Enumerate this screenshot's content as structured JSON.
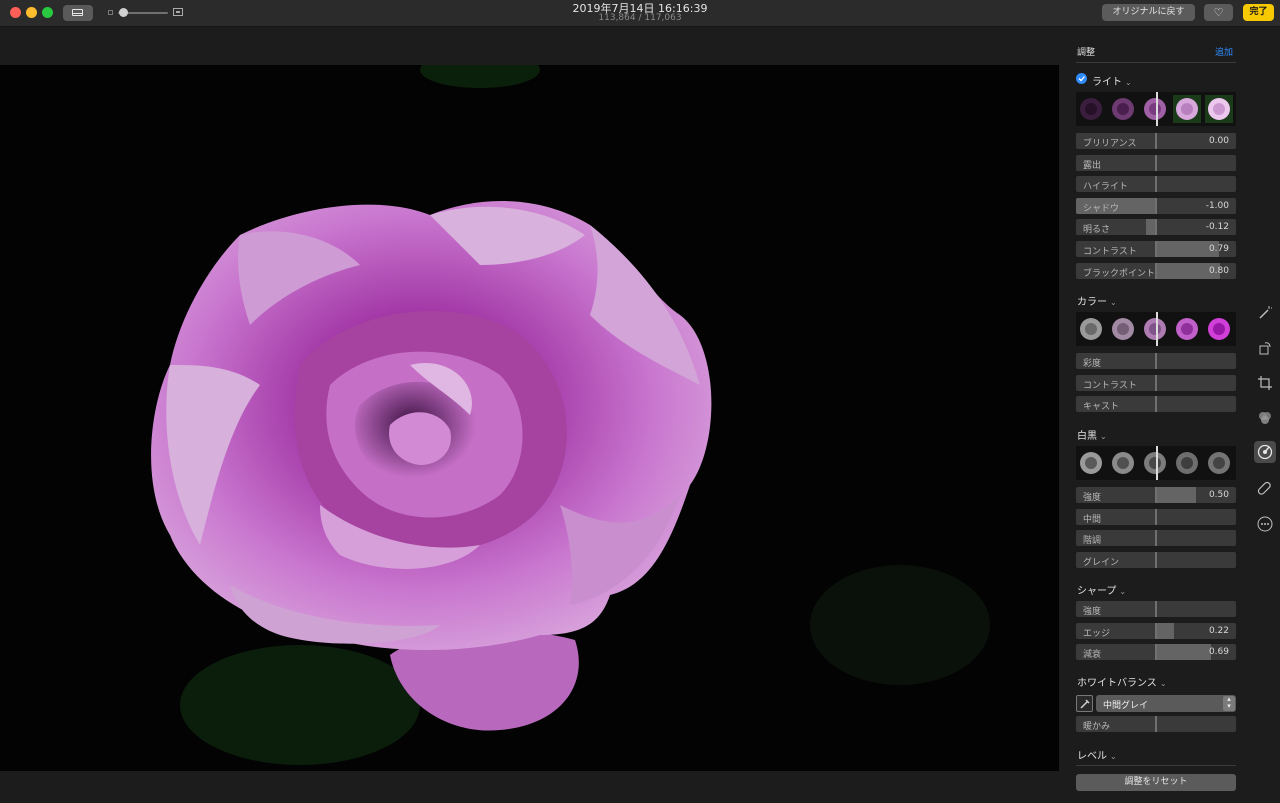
{
  "titlebar": {
    "title": "2019年7月14日 16:16:39",
    "subtitle": "113,864 / 117,063",
    "revert_label": "オリジナルに戻す",
    "favorite_icon": "heart-icon",
    "done_label": "完了"
  },
  "colors": {
    "accent_blue": "#2f8cff",
    "done_yellow": "#f7c900",
    "panel_bg": "#1c1c1c",
    "rose": "#c060c8"
  },
  "panel": {
    "title": "調整",
    "add_label": "追加",
    "light": {
      "label": "ライト",
      "enabled": true,
      "sliders": [
        {
          "label": "ブリリアンス",
          "value": "0.00",
          "level": 0
        },
        {
          "label": "露出",
          "value": "",
          "level": 0
        },
        {
          "label": "ハイライト",
          "value": "",
          "level": 0
        },
        {
          "label": "シャドウ",
          "value": "-1.00",
          "level": -1
        },
        {
          "label": "明るさ",
          "value": "-0.12",
          "level": -0.12
        },
        {
          "label": "コントラスト",
          "value": "0.79",
          "level": 0.79
        },
        {
          "label": "ブラックポイント",
          "value": "0.80",
          "level": 0.8
        }
      ]
    },
    "color": {
      "label": "カラー",
      "sliders": [
        {
          "label": "彩度",
          "value": "",
          "level": 0
        },
        {
          "label": "コントラスト",
          "value": "",
          "level": 0
        },
        {
          "label": "キャスト",
          "value": "",
          "level": 0
        }
      ]
    },
    "bw": {
      "label": "白黒",
      "sliders": [
        {
          "label": "強度",
          "value": "0.50",
          "level": 0.5
        },
        {
          "label": "中間",
          "value": "",
          "level": 0
        },
        {
          "label": "階調",
          "value": "",
          "level": 0
        },
        {
          "label": "グレイン",
          "value": "",
          "level": 0
        }
      ]
    },
    "sharpen": {
      "label": "シャープ",
      "sliders": [
        {
          "label": "強度",
          "value": "",
          "level": 0
        },
        {
          "label": "エッジ",
          "value": "0.22",
          "level": 0.22
        },
        {
          "label": "減衰",
          "value": "0.69",
          "level": 0.69
        }
      ]
    },
    "white_balance": {
      "label": "ホワイトバランス",
      "eyedropper_icon": "eyedropper-icon",
      "mode": "中間グレイ",
      "sliders": [
        {
          "label": "暖かみ",
          "value": "",
          "level": 0
        }
      ]
    },
    "levels": {
      "label": "レベル"
    },
    "reset_label": "調整をリセット"
  },
  "tools": [
    "magic-wand-icon",
    "rotate-icon",
    "crop-icon",
    "filters-icon",
    "adjust-icon",
    "retouch-icon",
    "more-icon"
  ]
}
